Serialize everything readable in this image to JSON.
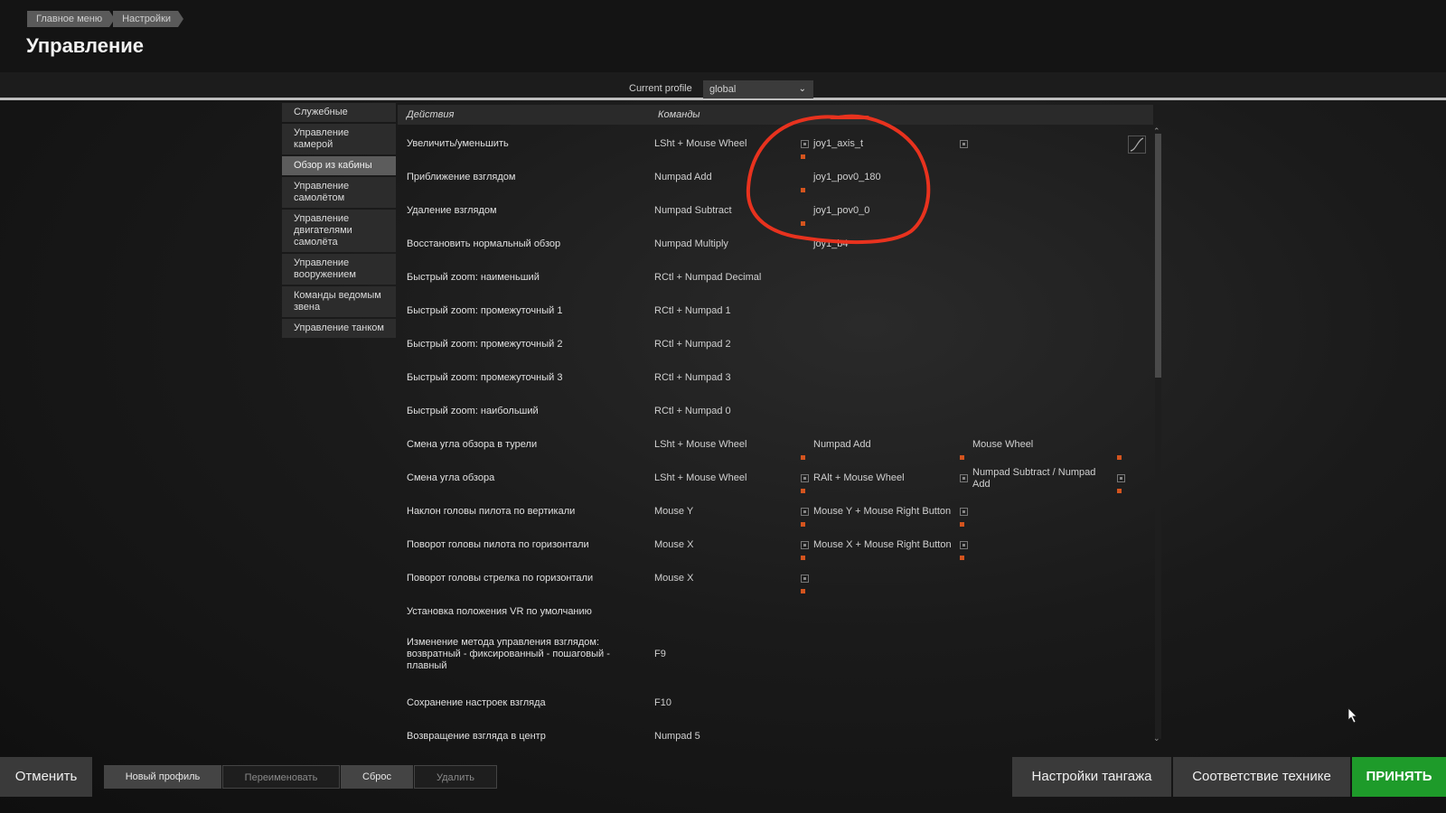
{
  "breadcrumb": [
    "Главное меню",
    "Настройки"
  ],
  "title": "Управление",
  "profile": {
    "label": "Current profile",
    "value": "global"
  },
  "categories": [
    {
      "label": "Служебные"
    },
    {
      "label": "Управление камерой"
    },
    {
      "label": "Обзор из кабины",
      "active": true
    },
    {
      "label": "Управление самолётом"
    },
    {
      "label": "Управление двигателями самолёта"
    },
    {
      "label": "Управление вооружением"
    },
    {
      "label": "Команды ведомым звена"
    },
    {
      "label": "Управление танком"
    }
  ],
  "table": {
    "headers": {
      "actions": "Действия",
      "commands": "Команды"
    },
    "rows": [
      {
        "action": "Увеличить/уменьшить",
        "c1": "LSht + Mouse Wheel",
        "c2": "joy1_axis_t",
        "c3": ""
      },
      {
        "action": "Приближение взглядом",
        "c1": "Numpad Add",
        "c2": "joy1_pov0_180",
        "c3": ""
      },
      {
        "action": "Удаление взглядом",
        "c1": "Numpad Subtract",
        "c2": "joy1_pov0_0",
        "c3": ""
      },
      {
        "action": "Восстановить нормальный обзор",
        "c1": "Numpad Multiply",
        "c2": "joy1_b4",
        "c3": ""
      },
      {
        "action": "Быстрый zoom: наименьший",
        "c1": "RCtl + Numpad Decimal",
        "c2": "",
        "c3": ""
      },
      {
        "action": "Быстрый zoom: промежуточный 1",
        "c1": "RCtl + Numpad 1",
        "c2": "",
        "c3": ""
      },
      {
        "action": "Быстрый zoom: промежуточный 2",
        "c1": "RCtl + Numpad 2",
        "c2": "",
        "c3": ""
      },
      {
        "action": "Быстрый zoom: промежуточный 3",
        "c1": "RCtl + Numpad 3",
        "c2": "",
        "c3": ""
      },
      {
        "action": "Быстрый zoom: наибольший",
        "c1": "RCtl + Numpad 0",
        "c2": "",
        "c3": ""
      },
      {
        "action": "Смена угла обзора в турели",
        "c1": "LSht + Mouse Wheel",
        "c2": "Numpad Add",
        "c3": "Mouse Wheel"
      },
      {
        "action": "Смена угла обзора",
        "c1": "LSht + Mouse Wheel",
        "c2": "RAlt + Mouse Wheel",
        "c3": "Numpad Subtract / Numpad Add"
      },
      {
        "action": "Наклон головы пилота по вертикали",
        "c1": "Mouse Y",
        "c2": "Mouse Y + Mouse Right Button",
        "c3": ""
      },
      {
        "action": "Поворот головы пилота по горизонтали",
        "c1": "Mouse X",
        "c2": "Mouse X + Mouse Right Button",
        "c3": ""
      },
      {
        "action": "Поворот головы стрелка по горизонтали",
        "c1": "Mouse X",
        "c2": "",
        "c3": ""
      },
      {
        "action": "Установка положения VR по умолчанию",
        "c1": "",
        "c2": "",
        "c3": ""
      },
      {
        "action": "Изменение метода управления взглядом: возвратный - фиксированный - пошаговый - плавный",
        "c1": "F9",
        "c2": "",
        "c3": ""
      },
      {
        "action": "Сохранение настроек взгляда",
        "c1": "F10",
        "c2": "",
        "c3": ""
      },
      {
        "action": "Возвращение взгляда в центр",
        "c1": "Numpad 5",
        "c2": "",
        "c3": ""
      }
    ]
  },
  "footer": {
    "cancel": "Отменить",
    "new_profile": "Новый профиль",
    "rename": "Переименовать",
    "reset": "Сброс",
    "delete": "Удалить",
    "pitch_settings": "Настройки тангажа",
    "vehicle_match": "Соответствие технике",
    "accept": "ПРИНЯТЬ"
  },
  "colors": {
    "accent_green": "#1e9b2a",
    "annotation_red": "#e8321e",
    "icon_orange": "#d4541e"
  },
  "icons": [
    "curve-settings-icon",
    "mouse-cursor-icon",
    "modifier-icon",
    "binding-marker-icon"
  ]
}
